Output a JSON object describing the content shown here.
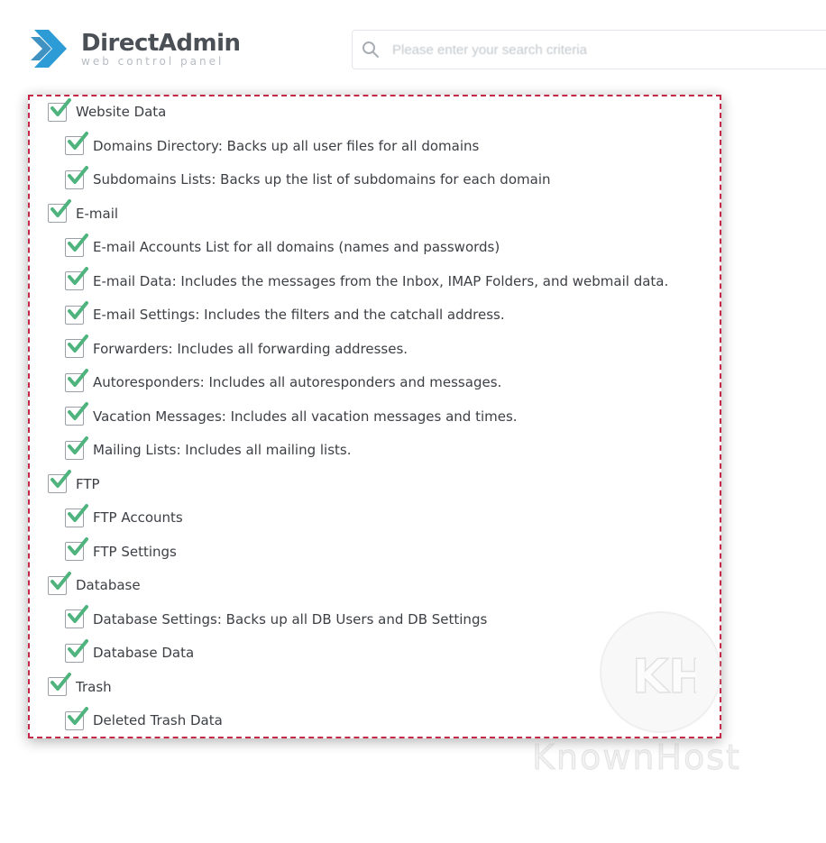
{
  "header": {
    "brand_name": "DirectAdmin",
    "brand_tagline": "web control panel",
    "search_placeholder": "Please enter your search criteria"
  },
  "colors": {
    "check": "#4fb37d",
    "dashed_border": "#c42a47",
    "logo_blue": "#2d9bd6"
  },
  "sections": [
    {
      "label": "Website Data",
      "checked": true,
      "items": [
        {
          "label": "Domains Directory: Backs up all user files for all domains",
          "checked": true
        },
        {
          "label": "Subdomains Lists: Backs up the list of subdomains for each domain",
          "checked": true
        }
      ]
    },
    {
      "label": "E-mail",
      "checked": true,
      "items": [
        {
          "label": "E-mail Accounts List for all domains (names and passwords)",
          "checked": true
        },
        {
          "label": "E-mail Data: Includes the messages from the Inbox, IMAP Folders, and webmail data.",
          "checked": true
        },
        {
          "label": "E-mail Settings: Includes the filters and the catchall address.",
          "checked": true
        },
        {
          "label": "Forwarders: Includes all forwarding addresses.",
          "checked": true
        },
        {
          "label": "Autoresponders: Includes all autoresponders and messages.",
          "checked": true
        },
        {
          "label": "Vacation Messages: Includes all vacation messages and times.",
          "checked": true
        },
        {
          "label": "Mailing Lists: Includes all mailing lists.",
          "checked": true
        }
      ]
    },
    {
      "label": "FTP",
      "checked": true,
      "items": [
        {
          "label": "FTP Accounts",
          "checked": true
        },
        {
          "label": "FTP Settings",
          "checked": true
        }
      ]
    },
    {
      "label": "Database",
      "checked": true,
      "items": [
        {
          "label": "Database Settings: Backs up all DB Users and DB Settings",
          "checked": true
        },
        {
          "label": "Database Data",
          "checked": true
        }
      ]
    },
    {
      "label": "Trash",
      "checked": true,
      "items": [
        {
          "label": "Deleted Trash Data",
          "checked": true
        }
      ]
    }
  ],
  "watermark": {
    "text": "KnownHost",
    "monogram": "KH"
  }
}
